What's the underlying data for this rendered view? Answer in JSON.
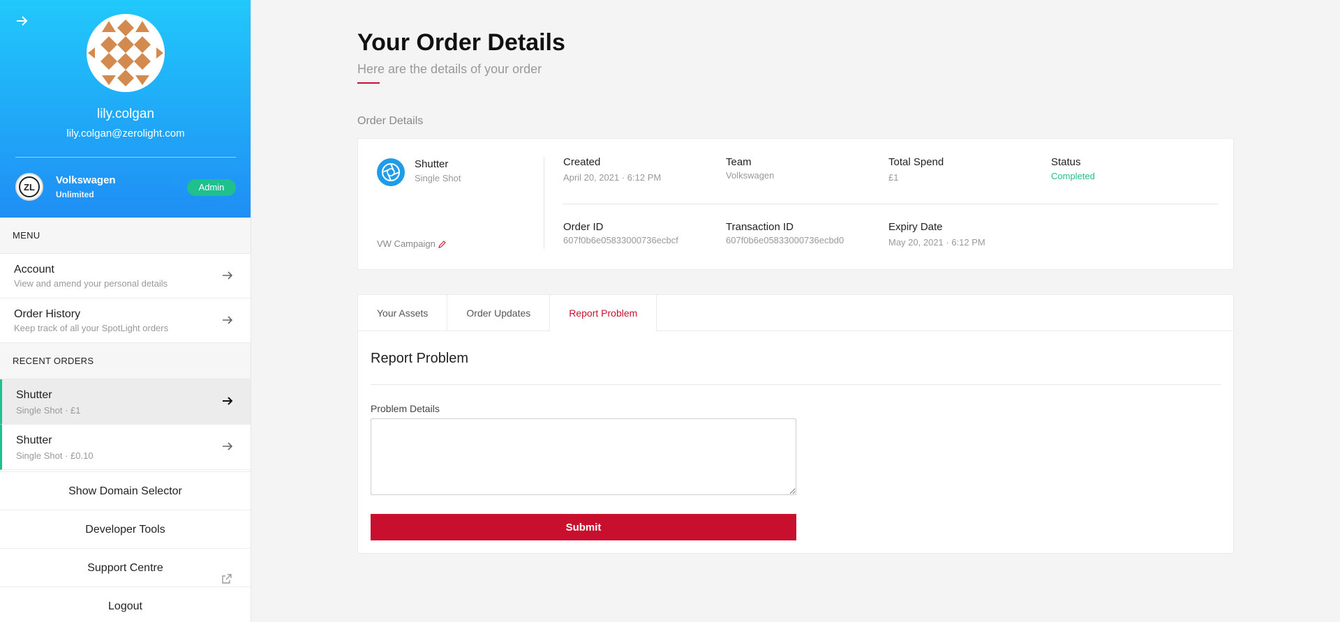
{
  "sidebar": {
    "profile": {
      "username": "lily.colgan",
      "email": "lily.colgan@zerolight.com",
      "team_logo_text": "ZL",
      "team_name": "Volkswagen",
      "team_plan": "Unlimited",
      "role_badge": "Admin"
    },
    "menu_label": "MENU",
    "menu_items": [
      {
        "title": "Account",
        "subtitle": "View and amend your personal details"
      },
      {
        "title": "Order History",
        "subtitle": "Keep track of all your SpotLight orders"
      }
    ],
    "recent_label": "RECENT ORDERS",
    "recent_orders": [
      {
        "title": "Shutter",
        "subtitle": "Single Shot · £1"
      },
      {
        "title": "Shutter",
        "subtitle": "Single Shot · £0.10"
      }
    ],
    "footer_links": {
      "domain_selector": "Show Domain Selector",
      "developer_tools": "Developer Tools",
      "support_centre": "Support Centre",
      "logout": "Logout"
    }
  },
  "main": {
    "title": "Your Order Details",
    "subtitle": "Here are the details of your order",
    "section_heading": "Order Details",
    "order": {
      "product_name": "Shutter",
      "product_type": "Single Shot",
      "campaign": "VW Campaign",
      "created_label": "Created",
      "created_value": "April 20, 2021 · 6:12 PM",
      "team_label": "Team",
      "team_value": "Volkswagen",
      "spend_label": "Total Spend",
      "spend_value": "£1",
      "status_label": "Status",
      "status_value": "Completed",
      "order_id_label": "Order ID",
      "order_id_value": "607f0b6e05833000736ecbcf",
      "transaction_id_label": "Transaction ID",
      "transaction_id_value": "607f0b6e05833000736ecbd0",
      "expiry_label": "Expiry Date",
      "expiry_value": "May 20, 2021 · 6:12 PM"
    },
    "tabs": [
      {
        "label": "Your Assets"
      },
      {
        "label": "Order Updates"
      },
      {
        "label": "Report Problem"
      }
    ],
    "report": {
      "title": "Report Problem",
      "field_label": "Problem Details",
      "textarea_value": "",
      "submit_label": "Submit"
    }
  },
  "colors": {
    "accent_red": "#c8102e",
    "status_green": "#1fc08e",
    "header_gradient_top": "#21c8fb",
    "header_gradient_bottom": "#1f8ef4"
  },
  "icons": {
    "back": "arrow-right-icon",
    "nav_arrow": "arrow-right-icon",
    "external": "external-link-icon",
    "edit": "pencil-icon",
    "product": "aperture-icon"
  }
}
